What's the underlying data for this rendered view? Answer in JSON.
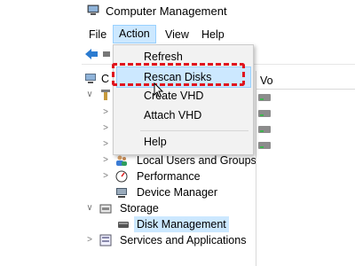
{
  "window": {
    "title": "Computer Management"
  },
  "menubar": {
    "items": [
      {
        "label": "File"
      },
      {
        "label": "Action"
      },
      {
        "label": "View"
      },
      {
        "label": "Help"
      }
    ]
  },
  "action_menu": {
    "items": [
      {
        "label": "Refresh"
      },
      {
        "label": "Rescan Disks"
      },
      {
        "label": "Create VHD"
      },
      {
        "label": "Attach VHD"
      },
      {
        "label": "Help"
      }
    ]
  },
  "tree": {
    "root_partial": "C",
    "items": [
      {
        "label": "Local Users and Groups"
      },
      {
        "label": "Performance"
      },
      {
        "label": "Device Manager"
      },
      {
        "label": "Storage"
      },
      {
        "label": "Disk Management"
      },
      {
        "label": "Services and Applications"
      }
    ]
  },
  "right_pane": {
    "column_header": "Vo"
  },
  "colors": {
    "highlight": "#cce8ff",
    "annotation_border": "#e0141e"
  }
}
